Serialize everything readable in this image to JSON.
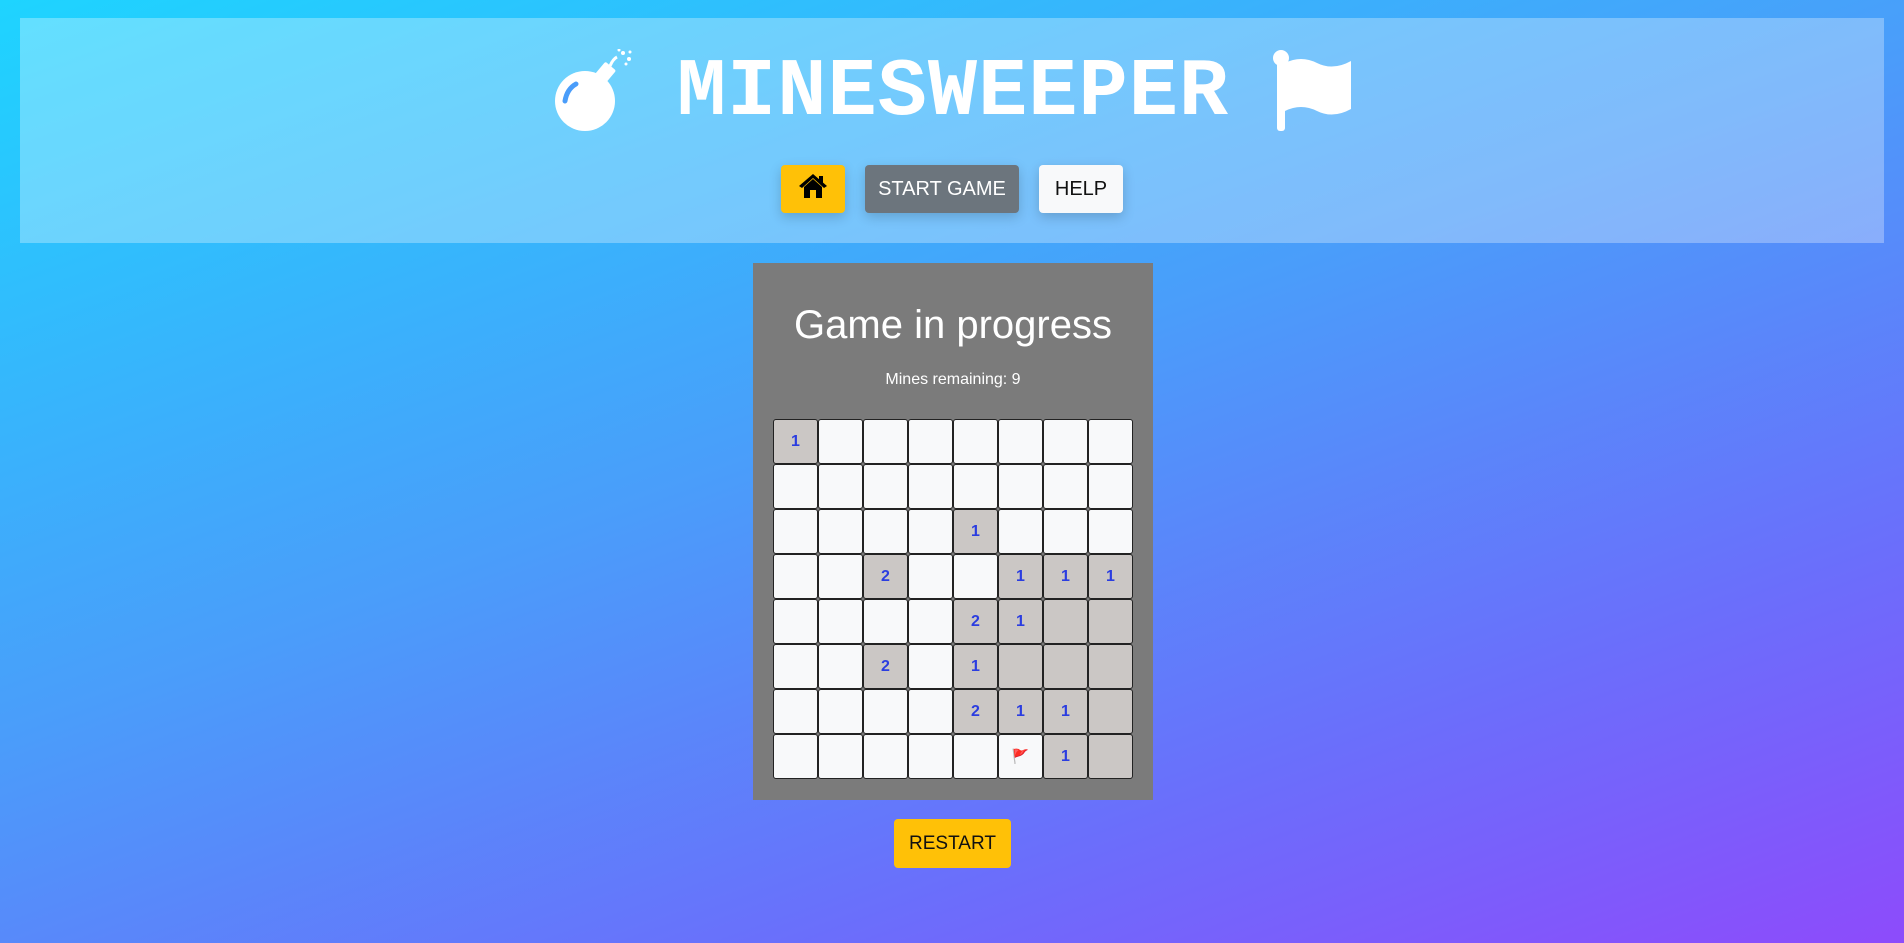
{
  "header": {
    "title": "MINESWEEPER",
    "left_icon": "bomb-icon",
    "right_icon": "flag-icon"
  },
  "nav": {
    "home_icon": "home-icon",
    "start_label": "START GAME",
    "help_label": "HELP"
  },
  "game": {
    "status": "Game in progress",
    "mines_label": "Mines remaining: 9",
    "board": [
      [
        "1",
        "h",
        "h",
        "h",
        "h",
        "h",
        "h",
        "h"
      ],
      [
        "h",
        "h",
        "h",
        "h",
        "h",
        "h",
        "h",
        "h"
      ],
      [
        "h",
        "h",
        "h",
        "h",
        "1",
        "h",
        "h",
        "h"
      ],
      [
        "h",
        "h",
        "2",
        "h",
        "h",
        "1",
        "1",
        "1"
      ],
      [
        "h",
        "h",
        "h",
        "h",
        "2",
        "1",
        "0",
        "0"
      ],
      [
        "h",
        "h",
        "2",
        "h",
        "1",
        "0",
        "0",
        "0"
      ],
      [
        "h",
        "h",
        "h",
        "h",
        "2",
        "1",
        "1",
        "0"
      ],
      [
        "h",
        "h",
        "h",
        "h",
        "h",
        "F",
        "1",
        "0"
      ]
    ],
    "flag_glyph": "🚩"
  },
  "restart_label": "RESTART",
  "colors": {
    "accent": "#ffc107",
    "secondary": "#6c757d",
    "revealed": "#cbc7c5",
    "number": "#2b3de0",
    "panel": "#7b7b7b"
  }
}
